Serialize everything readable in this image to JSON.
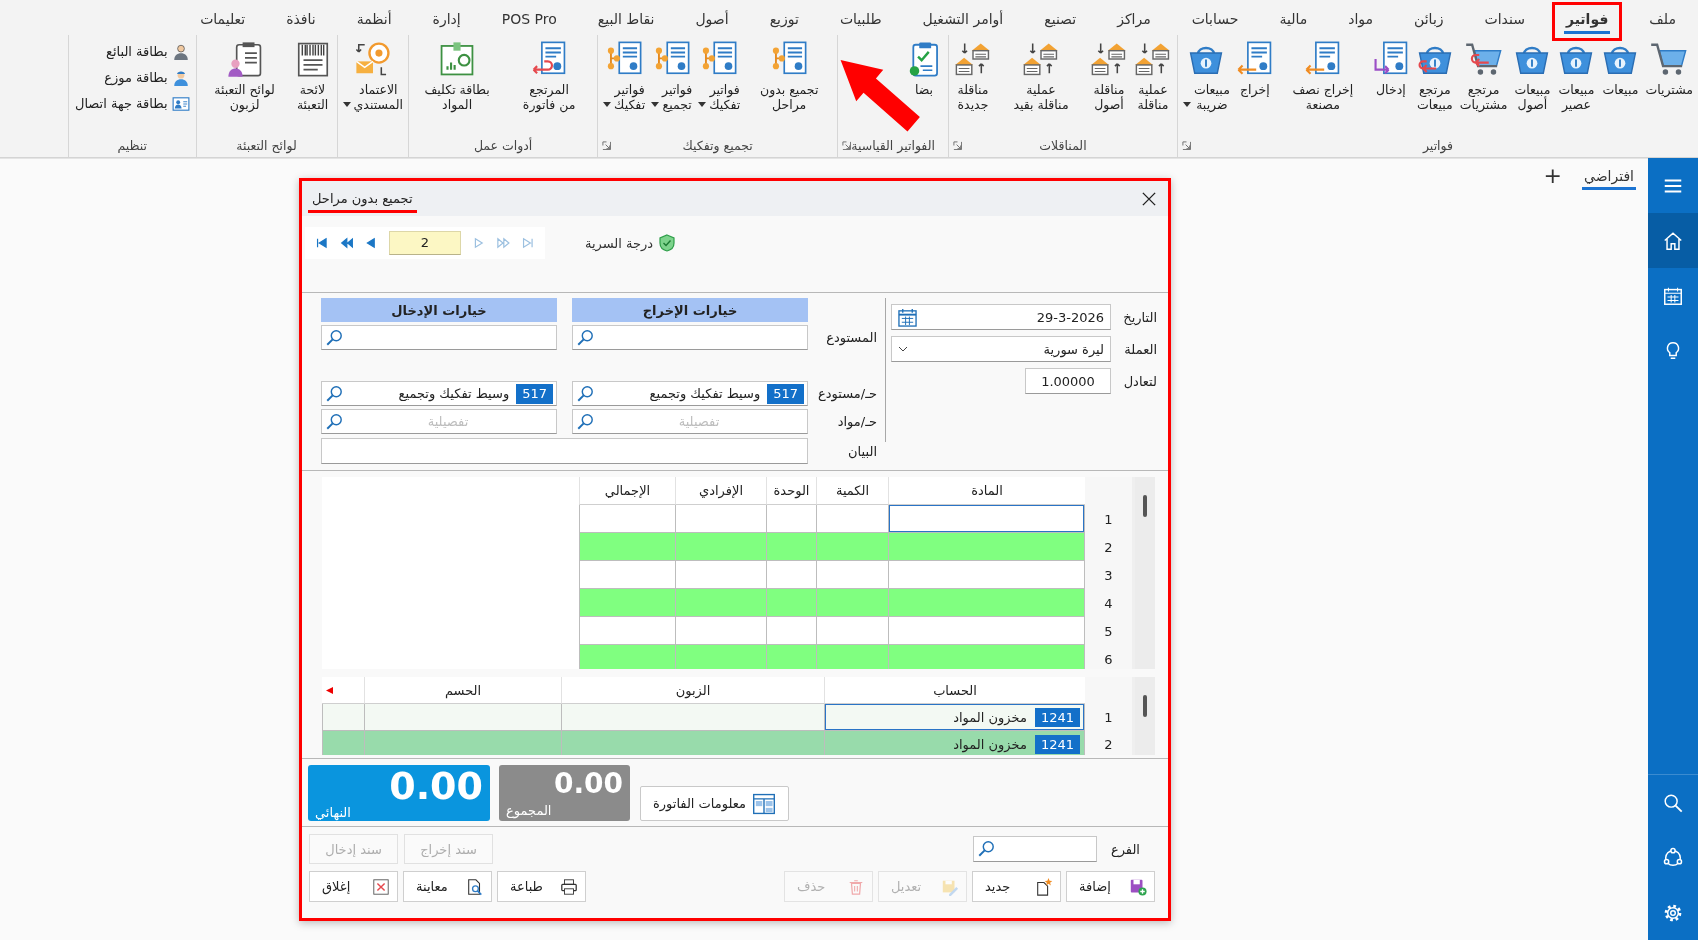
{
  "menu_tabs": [
    {
      "label": "ملف",
      "selected": false,
      "highlighted": false
    },
    {
      "label": "فواتير",
      "selected": true,
      "highlighted": true
    },
    {
      "label": "سندات",
      "selected": false,
      "highlighted": false
    },
    {
      "label": "زبائن",
      "selected": false,
      "highlighted": false
    },
    {
      "label": "مواد",
      "selected": false,
      "highlighted": false
    },
    {
      "label": "مالية",
      "selected": false,
      "highlighted": false
    },
    {
      "label": "حسابات",
      "selected": false,
      "highlighted": false
    },
    {
      "label": "مراكز",
      "selected": false,
      "highlighted": false
    },
    {
      "label": "تصنيع",
      "selected": false,
      "highlighted": false
    },
    {
      "label": "أوامر التشغيل",
      "selected": false,
      "highlighted": false
    },
    {
      "label": "طلبيات",
      "selected": false,
      "highlighted": false
    },
    {
      "label": "توزيع",
      "selected": false,
      "highlighted": false
    },
    {
      "label": "أصول",
      "selected": false,
      "highlighted": false
    },
    {
      "label": "نقاط البيع",
      "selected": false,
      "highlighted": false
    },
    {
      "label": "POS Pro",
      "selected": false,
      "highlighted": false
    },
    {
      "label": "إدارة",
      "selected": false,
      "highlighted": false
    },
    {
      "label": "أنظمة",
      "selected": false,
      "highlighted": false
    },
    {
      "label": "نافذة",
      "selected": false,
      "highlighted": false
    },
    {
      "label": "تعليمات",
      "selected": false,
      "highlighted": false
    }
  ],
  "ribbon": [
    {
      "label": "فواتير",
      "kind": "large",
      "launcher": true,
      "annotated": false,
      "items": [
        {
          "label": "مشتريات",
          "kind": "cart",
          "dropdown": false
        },
        {
          "label": "مبيعات",
          "kind": "basket",
          "dropdown": false
        },
        {
          "label": "مبيعات عصير",
          "kind": "basket",
          "dropdown": false
        },
        {
          "label": "مبيعات أصول",
          "kind": "basket",
          "dropdown": false
        },
        {
          "label": "مرتجع مشتريات",
          "kind": "cartback",
          "dropdown": false
        },
        {
          "label": "مرتجع مبيعات",
          "kind": "basketback",
          "dropdown": false
        },
        {
          "label": "إدخال",
          "kind": "docin",
          "dropdown": false
        },
        {
          "label": "إخراج نصف مصنعة",
          "kind": "docout",
          "dropdown": false
        },
        {
          "label": "إخراج",
          "kind": "docout",
          "dropdown": false
        },
        {
          "label": "مبيعات ضريبة",
          "kind": "basket",
          "dropdown": true
        }
      ]
    },
    {
      "label": "المناقلات",
      "kind": "large",
      "launcher": true,
      "annotated": false,
      "items": [
        {
          "label": "عملية مناقلة",
          "kind": "transfer",
          "dropdown": false
        },
        {
          "label": "مناقلة أصول",
          "kind": "transfer",
          "dropdown": false
        },
        {
          "label": "عملية مناقلة بقيد",
          "kind": "transfer",
          "dropdown": false
        },
        {
          "label": "مناقلة جديدة",
          "kind": "transfer",
          "dropdown": false
        }
      ]
    },
    {
      "label": "الفواتير القياسية",
      "kind": "large",
      "launcher": true,
      "annotated": true,
      "items": [
        {
          "label": "بضا",
          "kind": "checklist",
          "dropdown": false
        }
      ]
    },
    {
      "label": "تجميع وتفكيك",
      "kind": "large",
      "launcher": true,
      "annotated": false,
      "items": [
        {
          "label": "تجميع بدون مراحل",
          "kind": "assembly",
          "dropdown": false
        },
        {
          "label": "فواتير تفكيك",
          "kind": "assembly",
          "dropdown": true
        },
        {
          "label": "فواتير تجميع",
          "kind": "assembly",
          "dropdown": true
        },
        {
          "label": "فواتير تفكيك",
          "kind": "assembly",
          "dropdown": true
        }
      ]
    },
    {
      "label": "أدوات عمل",
      "kind": "large",
      "launcher": false,
      "annotated": false,
      "items": [
        {
          "label": "المرتجع من فاتورة",
          "kind": "docreturn",
          "dropdown": false
        },
        {
          "label": "بطاقة تكليف المواد",
          "kind": "costcard",
          "dropdown": false
        }
      ]
    },
    {
      "kind": "large",
      "launcher": false,
      "annotated": false,
      "items": [
        {
          "label": "الاعتماد المستندي",
          "kind": "credit",
          "dropdown": true
        }
      ]
    },
    {
      "label": "لوائح التعبئة",
      "kind": "large",
      "launcher": false,
      "annotated": false,
      "items": [
        {
          "label": "لائحة التعبئة",
          "kind": "barcodes",
          "dropdown": false
        },
        {
          "label": "لوائح التعبئة لزبون",
          "kind": "clipboard",
          "dropdown": false
        }
      ]
    },
    {
      "label": "تنظيم",
      "kind": "small",
      "launcher": false,
      "annotated": false,
      "items": [
        {
          "label": "بطاقة البائع",
          "kind": "seller",
          "dropdown": false
        },
        {
          "label": "بطاقة موزع",
          "kind": "courier",
          "dropdown": false
        },
        {
          "label": "بطاقة جهة اتصال",
          "kind": "contact",
          "dropdown": false
        }
      ]
    }
  ],
  "workspace_tabs": [
    {
      "label": "افتراضي",
      "selected": true
    }
  ],
  "add_tab": "+",
  "sidebar": {
    "top": [
      {
        "kind": "menu",
        "selected": false
      },
      {
        "kind": "home",
        "selected": true
      },
      {
        "kind": "calendar",
        "selected": false
      },
      {
        "kind": "bulb",
        "selected": false
      }
    ],
    "bottom": [
      {
        "kind": "search"
      },
      {
        "kind": "share"
      },
      {
        "kind": "settings"
      }
    ]
  },
  "dialog": {
    "title": "تجميع بدون مراحل",
    "highlighted": true,
    "navigator": {
      "back": [
        {
          "kind": "first",
          "disabled": false
        },
        {
          "kind": "rewind",
          "disabled": false
        },
        {
          "kind": "prev",
          "disabled": false
        }
      ],
      "record": "2",
      "forward": [
        {
          "kind": "next",
          "disabled": true
        },
        {
          "kind": "forward",
          "disabled": true
        },
        {
          "kind": "last",
          "disabled": true
        }
      ]
    },
    "security": {
      "label": "درجة السرية"
    },
    "header_fields": [
      {
        "label": "التاريخ",
        "value": "29-3-2026",
        "kind": "date"
      },
      {
        "label": "العملة",
        "value": "ليرة سورية",
        "kind": "select"
      },
      {
        "label": "لتعادل",
        "value": "1.00000",
        "kind": "number"
      }
    ],
    "options": {
      "headers": [
        "خيارات الإخراج",
        "خيارات الإدخال"
      ],
      "rows": [
        {
          "label": "المستودع",
          "fields": [
            {
              "kind": "search"
            },
            {
              "kind": "search"
            }
          ]
        },
        {
          "label": "حـ/مستودع",
          "fields": [
            {
              "kind": "search",
              "code": "517",
              "value": "وسيط تفكيك وتجميع"
            },
            {
              "kind": "search",
              "code": "517",
              "value": "وسيط تفكيك وتجميع"
            }
          ]
        },
        {
          "label": "حـ/مواد",
          "fields": [
            {
              "kind": "search",
              "placeholder": "تفصيلية"
            },
            {
              "kind": "search",
              "placeholder": "تفصيلية"
            }
          ]
        },
        {
          "label": "البيان",
          "fields": [
            {
              "kind": "text"
            }
          ]
        }
      ]
    },
    "items_grid": {
      "columns": [
        "المادة",
        "الكمية",
        "الوحدة",
        "الإفرادي",
        "الإجمالي"
      ],
      "rows": [
        {
          "number": "1",
          "focused": true
        },
        {
          "number": "2",
          "focused": false
        },
        {
          "number": "3",
          "focused": false
        },
        {
          "number": "4",
          "focused": false
        },
        {
          "number": "5",
          "focused": false
        },
        {
          "number": "6",
          "focused": false
        }
      ]
    },
    "accounts_grid": {
      "columns": [
        "الحساب",
        "الزبون",
        "الحسم"
      ],
      "rows": [
        {
          "number": "1",
          "code": "1241",
          "account": "مخزون المواد",
          "focused": true
        },
        {
          "number": "2",
          "code": "1241",
          "account": "مخزون المواد",
          "focused": false
        }
      ]
    },
    "invoice_info": "معلومات الفاتورة",
    "totals": [
      {
        "kind": "sum",
        "label": "المجموع",
        "value": "0.00"
      },
      {
        "kind": "final",
        "label": "النهائي",
        "value": "0.00"
      }
    ],
    "branch": {
      "label": "الفرع"
    },
    "vouchers": [
      {
        "label": "سند إخراج",
        "disabled": true
      },
      {
        "label": "سند إدخال",
        "disabled": true
      }
    ],
    "actions_right": [
      {
        "label": "إضافة",
        "kind": "add",
        "disabled": false
      },
      {
        "label": "جديد",
        "kind": "new",
        "disabled": false
      },
      {
        "label": "تعديل",
        "kind": "edit",
        "disabled": true
      },
      {
        "label": "حذف",
        "kind": "delete",
        "disabled": true
      }
    ],
    "actions_left": [
      {
        "label": "طباعة",
        "kind": "print",
        "disabled": false
      },
      {
        "label": "معاينة",
        "kind": "preview",
        "disabled": false
      },
      {
        "label": "إغلاق",
        "kind": "close",
        "disabled": false
      }
    ]
  }
}
